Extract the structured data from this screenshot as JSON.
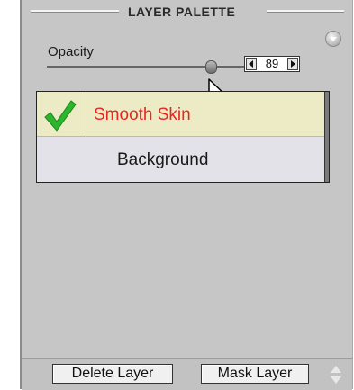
{
  "panel": {
    "title": "LAYER PALETTE",
    "menu_icon": "chevron-down-circle-icon"
  },
  "opacity": {
    "label": "Opacity",
    "value": "89",
    "slider_level": 89,
    "decrement_icon": "triangle-left-icon",
    "increment_icon": "triangle-right-icon"
  },
  "layers": [
    {
      "name": "Smooth Skin",
      "selected": true,
      "check_icon": "checkmark-icon",
      "name_color": "#e8281e"
    },
    {
      "name": "Background",
      "selected": false
    }
  ],
  "footer": {
    "delete_label": "Delete Layer",
    "mask_label": "Mask Layer",
    "scroll_icon": "up-down-arrows-icon"
  },
  "colors": {
    "panel_bg": "#c6c6c6",
    "selected_row_bg": "#ecebc6",
    "accent_check": "#2db52d"
  }
}
